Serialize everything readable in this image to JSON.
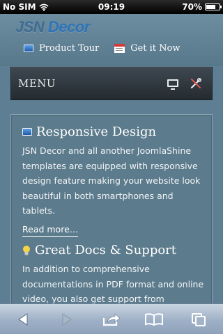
{
  "status_bar": {
    "carrier": "No SIM",
    "time": "09:19",
    "battery_percent": "70%",
    "battery_level": 0.7,
    "wifi_icon": "wifi-icon"
  },
  "header": {
    "logo_part1": "JSN",
    "logo_part2": "Decor",
    "links": [
      {
        "label": "Product Tour",
        "icon": "monitor-icon"
      },
      {
        "label": "Get it Now",
        "icon": "calendar-icon"
      }
    ]
  },
  "menu": {
    "label": "MENU",
    "icons": [
      "desktop-icon",
      "tools-icon"
    ]
  },
  "sections": [
    {
      "icon": "monitor-icon",
      "title": "Responsive Design",
      "body": "JSN Decor and all another JoomlaShine templates are equipped with responsive design feature making your website look beautiful in both smartphones and tablets.",
      "link": "Read more…"
    },
    {
      "icon": "lightbulb-icon",
      "title": "Great Docs & Support",
      "body": "In addition to comprehensive documentations in PDF format and online video, you also get support from"
    }
  ],
  "toolbar": {
    "buttons": [
      "back-icon",
      "forward-icon",
      "share-icon",
      "bookmarks-icon",
      "pages-icon"
    ]
  },
  "colors": {
    "background": "#5e7f93",
    "menu_bar": "#2f373e",
    "logo": "#2f74b8",
    "toolbar": "#9eb0c6"
  }
}
